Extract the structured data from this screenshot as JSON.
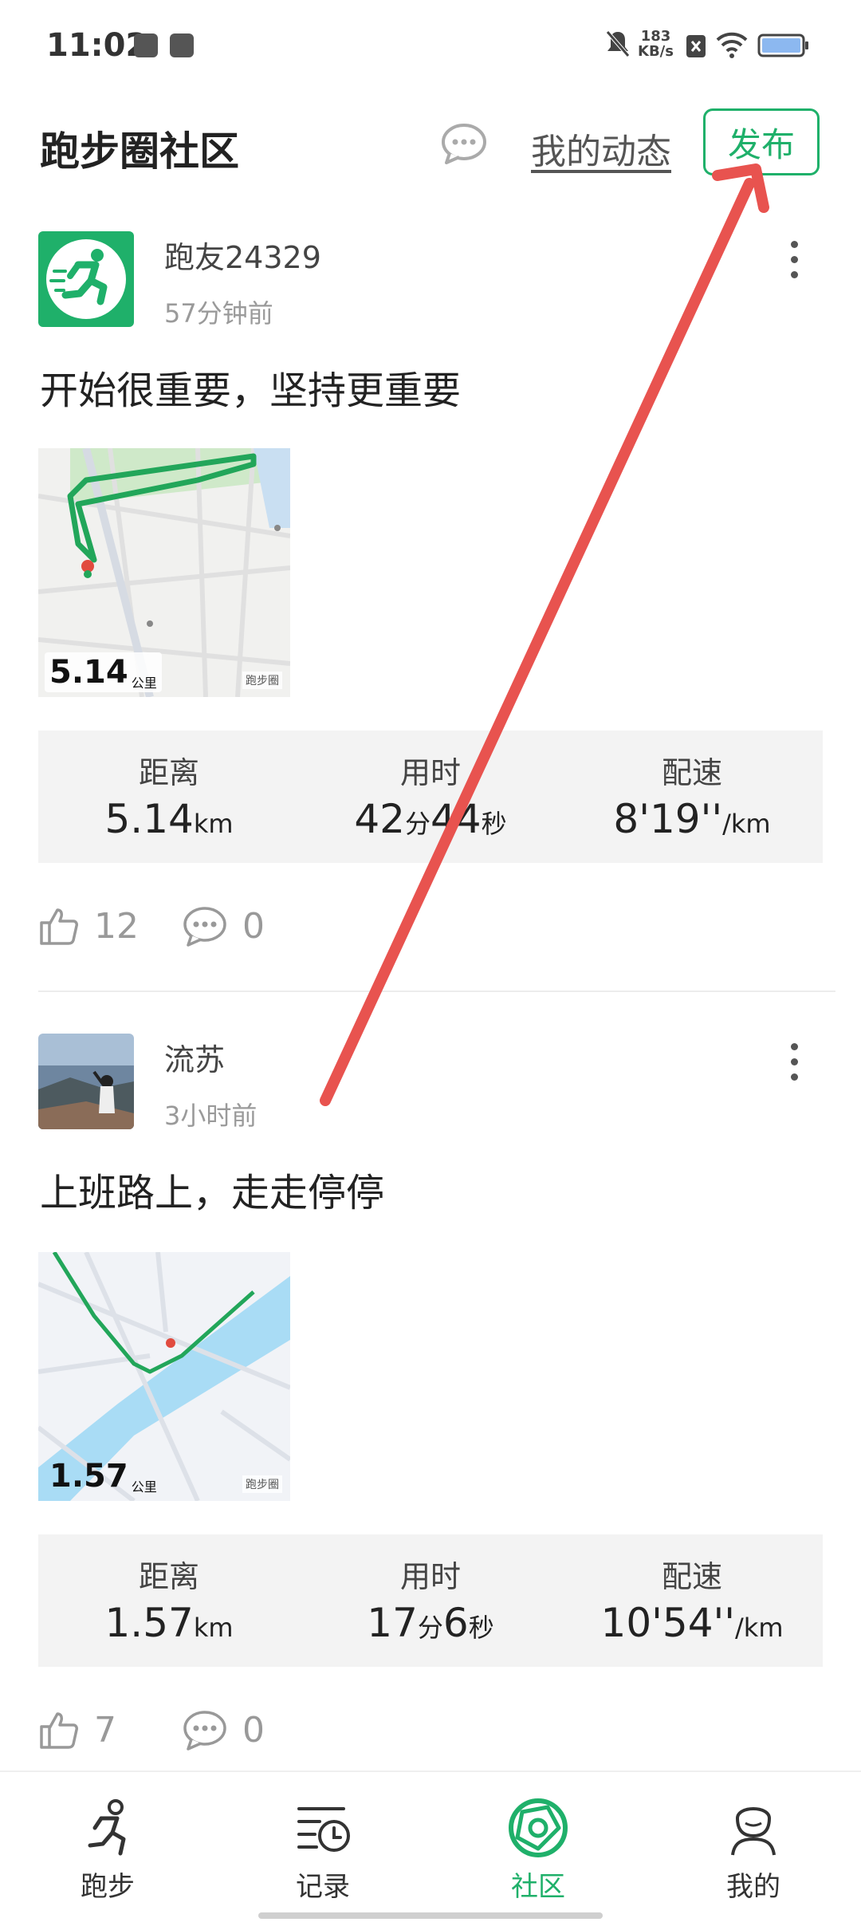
{
  "status_bar": {
    "time": "11:02",
    "net_speed_value": "183",
    "net_speed_unit": "KB/s"
  },
  "header": {
    "title": "跑步圈社区",
    "my_activity": "我的动态",
    "publish_button": "发布"
  },
  "posts": [
    {
      "username": "跑友24329",
      "time": "57分钟前",
      "content": "开始很重要，坚持更重要",
      "map_distance": "5.14",
      "map_unit": "公里",
      "map_brand": "跑步圈",
      "stats": [
        {
          "label": "距离",
          "value_num": "5.14",
          "value_unit": "km"
        },
        {
          "label": "用时",
          "value_num": "42",
          "value_unit": "分",
          "value_num2": "44",
          "value_unit2": "秒"
        },
        {
          "label": "配速",
          "value_num": "8'19''",
          "value_unit": "/km"
        }
      ],
      "likes": "12",
      "comments": "0"
    },
    {
      "username": "流苏",
      "time": "3小时前",
      "content": "上班路上，走走停停",
      "map_distance": "1.57",
      "map_unit": "公里",
      "map_brand": "跑步圈",
      "stats": [
        {
          "label": "距离",
          "value_num": "1.57",
          "value_unit": "km"
        },
        {
          "label": "用时",
          "value_num": "17",
          "value_unit": "分",
          "value_num2": "6",
          "value_unit2": "秒"
        },
        {
          "label": "配速",
          "value_num": "10'54''",
          "value_unit": "/km"
        }
      ],
      "likes": "7",
      "comments": "0"
    }
  ],
  "tabbar": {
    "items": [
      {
        "label": "跑步",
        "icon": "runner-icon"
      },
      {
        "label": "记录",
        "icon": "history-icon"
      },
      {
        "label": "社区",
        "icon": "community-icon",
        "active": true
      },
      {
        "label": "我的",
        "icon": "profile-icon"
      }
    ]
  },
  "colors": {
    "accent": "#1fb06a",
    "annotation_arrow": "#e8534f"
  }
}
